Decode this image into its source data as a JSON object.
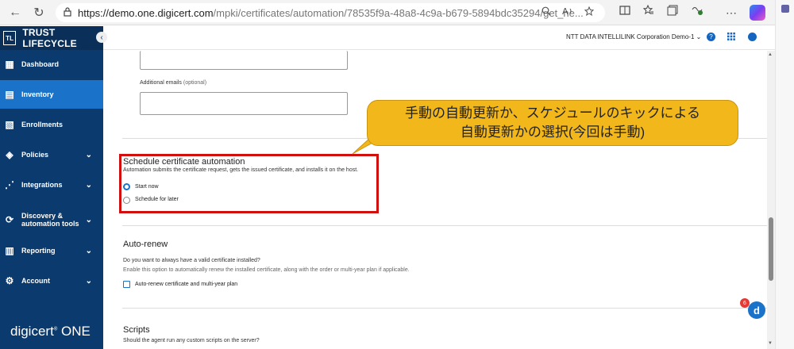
{
  "browser": {
    "url_host": "https://demo.one.digicert.com",
    "url_path": "/mpki/certificates/automation/78535f9a-48a8-4c9a-b679-5894bdc35294/get_ne...",
    "back_icon": "←",
    "refresh_icon": "↻",
    "lock_icon": "🔒"
  },
  "sidebar": {
    "brand": "TRUST LIFECYCLE",
    "brand_logo": "TL",
    "items": [
      {
        "label": "Dashboard",
        "icon": "▦"
      },
      {
        "label": "Inventory",
        "icon": "▤"
      },
      {
        "label": "Enrollments",
        "icon": "▧"
      },
      {
        "label": "Policies",
        "icon": "◈"
      },
      {
        "label": "Integrations",
        "icon": "⋰"
      },
      {
        "label": "Discovery &",
        "label2": "automation tools",
        "icon": "⟳"
      },
      {
        "label": "Reporting",
        "icon": "▥"
      },
      {
        "label": "Account",
        "icon": "⚙"
      }
    ],
    "footer_brand": "digicert",
    "footer_brand_suffix": "ONE"
  },
  "topbar": {
    "org": "NTT DATA INTELLILINK Corporation Demo-1",
    "help": "?"
  },
  "form": {
    "additional_emails_label": "Additional emails",
    "optional": "(optional)",
    "schedule": {
      "title": "Schedule certificate automation",
      "desc": "Automation submits the certificate request, gets the issued certificate, and installs it on the host.",
      "options": [
        "Start now",
        "Schedule for later"
      ],
      "selected": "Start now"
    },
    "autorenew": {
      "title": "Auto-renew",
      "question": "Do you want to always have a valid certificate installed?",
      "desc": "Enable this option to automatically renew the installed certificate, along with the order or multi-year plan if applicable.",
      "checkbox_label": "Auto-renew certificate and multi-year plan"
    },
    "scripts": {
      "title": "Scripts",
      "question": "Should the agent run any custom scripts on the server?"
    }
  },
  "callout": {
    "line1": "手動の自動更新か、スケジュールのキックによる",
    "line2": "自動更新かの選択(今回は手動)"
  },
  "fab": {
    "letter": "d",
    "badge": "6"
  },
  "colors": {
    "sidebar": "#0b3a6e",
    "active": "#1a73c9",
    "highlight": "#d10f0f",
    "callout": "#f2b71a"
  }
}
